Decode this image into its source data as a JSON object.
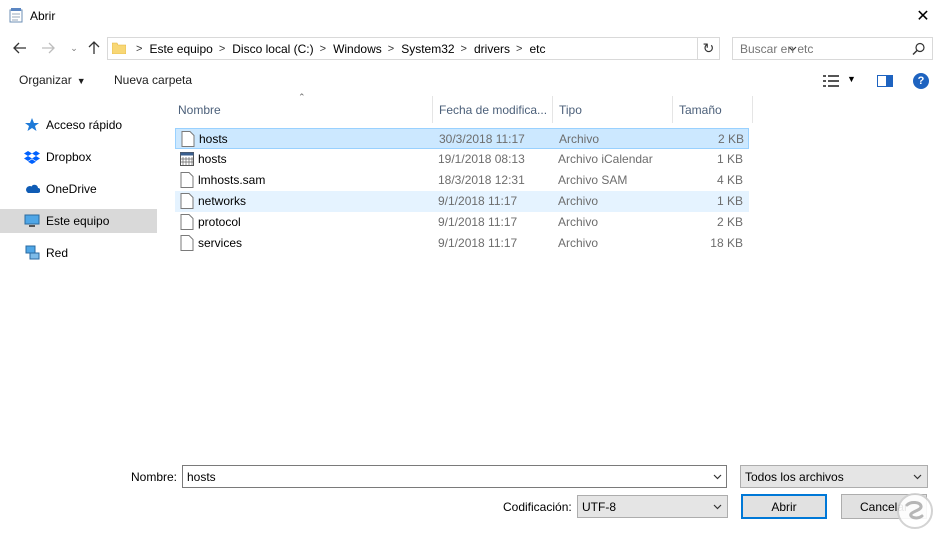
{
  "window": {
    "title": "Abrir"
  },
  "addressbar": {
    "crumbs": [
      "Este equipo",
      "Disco local (C:)",
      "Windows",
      "System32",
      "drivers",
      "etc"
    ]
  },
  "search": {
    "placeholder": "Buscar en etc"
  },
  "toolbar": {
    "organize_label": "Organizar",
    "new_folder_label": "Nueva carpeta"
  },
  "navpane": {
    "items": [
      {
        "label": "Acceso rápido",
        "icon": "star-icon"
      },
      {
        "label": "Dropbox",
        "icon": "dropbox-icon"
      },
      {
        "label": "OneDrive",
        "icon": "cloud-icon"
      },
      {
        "label": "Este equipo",
        "icon": "computer-icon"
      },
      {
        "label": "Red",
        "icon": "network-icon"
      }
    ]
  },
  "filelist": {
    "columns": [
      "Nombre",
      "Fecha de modifica...",
      "Tipo",
      "Tamaño"
    ],
    "rows": [
      {
        "name": "hosts",
        "date": "30/3/2018 11:17",
        "type": "Archivo",
        "size": "2 KB",
        "icon": "file-icon"
      },
      {
        "name": "hosts",
        "date": "19/1/2018 08:13",
        "type": "Archivo iCalendar",
        "size": "1 KB",
        "icon": "calendar-file-icon"
      },
      {
        "name": "lmhosts.sam",
        "date": "18/3/2018 12:31",
        "type": "Archivo SAM",
        "size": "4 KB",
        "icon": "file-icon"
      },
      {
        "name": "networks",
        "date": "9/1/2018 11:17",
        "type": "Archivo",
        "size": "1 KB",
        "icon": "file-icon"
      },
      {
        "name": "protocol",
        "date": "9/1/2018 11:17",
        "type": "Archivo",
        "size": "2 KB",
        "icon": "file-icon"
      },
      {
        "name": "services",
        "date": "9/1/2018 11:17",
        "type": "Archivo",
        "size": "18 KB",
        "icon": "file-icon"
      }
    ]
  },
  "bottom": {
    "name_label": "Nombre:",
    "name_value": "hosts",
    "filetype_value": "Todos los archivos",
    "encoding_label": "Codificación:",
    "encoding_value": "UTF-8",
    "open_label": "Abrir",
    "cancel_label": "Cancelar"
  },
  "colors": {
    "accent": "#0078d7",
    "selection": "#cce8ff",
    "hover": "#e5f3ff"
  }
}
